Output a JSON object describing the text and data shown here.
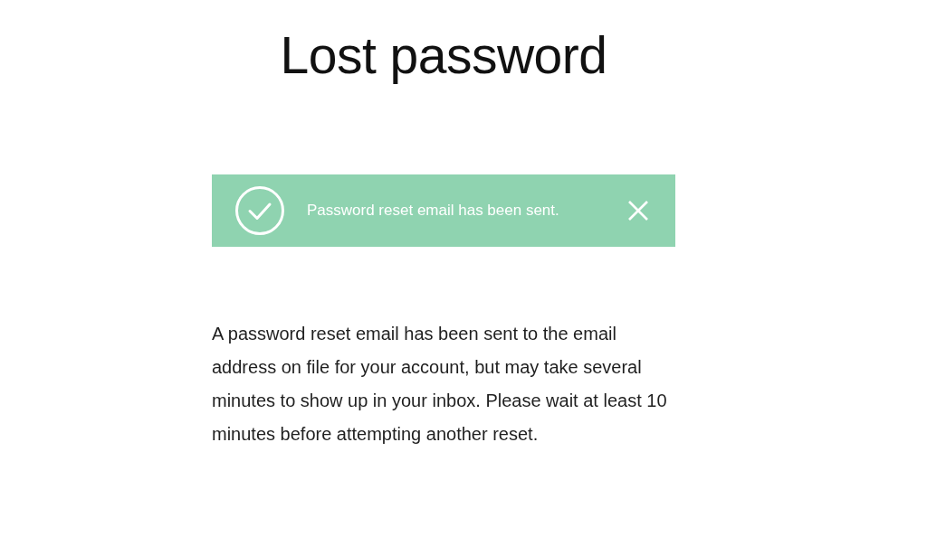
{
  "page": {
    "title": "Lost password"
  },
  "notice": {
    "kind": "success",
    "message": "Password reset email has been sent.",
    "dismissible": true
  },
  "body": "A password reset email has been sent to the email address on file for your account, but may take several minutes to show up in your inbox. Please wait at least 10 minutes before attempting another reset."
}
